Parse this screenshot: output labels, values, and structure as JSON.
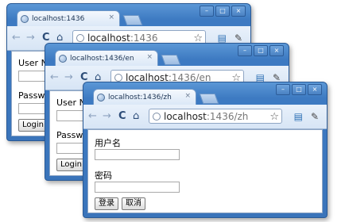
{
  "windows": [
    {
      "tab_title": "localhost:1436",
      "url_host": "localhost",
      "url_path": ":1436",
      "form": {
        "username_label": "User Name",
        "password_label": "Password",
        "login_button": "Login"
      }
    },
    {
      "tab_title": "localhost:1436/en",
      "url_host": "localhost",
      "url_path": ":1436/en",
      "form": {
        "username_label": "User Name",
        "password_label": "Password",
        "login_button": "Login"
      }
    },
    {
      "tab_title": "localhost:1436/zh",
      "url_host": "localhost",
      "url_path": ":1436/zh",
      "form": {
        "username_label": "用户名",
        "password_label": "密码",
        "login_button": "登录",
        "cancel_button": "取消"
      }
    }
  ],
  "chrome": {
    "tab_close": "×",
    "minimize": "–",
    "maximize": "□",
    "close": "×",
    "back": "←",
    "forward": "→",
    "reload": "C",
    "home": "⌂",
    "star": "☆",
    "page_menu": "▤",
    "wrench": "✎"
  },
  "colors": {
    "frame": "#3d7ac2",
    "tab": "#dbe8f7"
  }
}
